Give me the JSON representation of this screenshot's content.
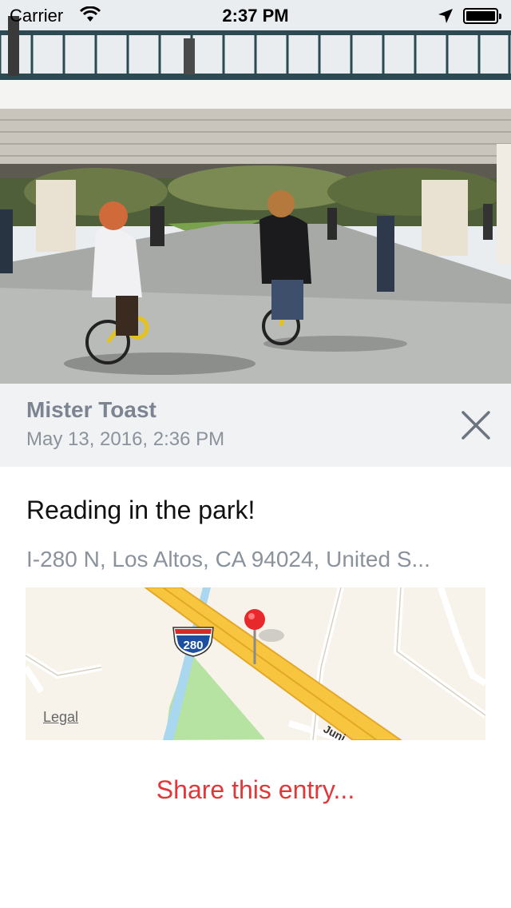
{
  "status_bar": {
    "carrier": "Carrier",
    "time": "2:37 PM",
    "icons": [
      "wifi-icon",
      "location-arrow-icon",
      "battery-icon"
    ]
  },
  "photo": {
    "subject": "photo-cyclists-under-bridge"
  },
  "entry": {
    "author": "Mister Toast",
    "date": "May 13, 2016, 2:36 PM",
    "title": "Reading in the park!",
    "address": "I-280 N, Los Altos, CA  94024, United S..."
  },
  "map": {
    "highway_shield": "280",
    "street_label": "Juni",
    "legal_label": "Legal"
  },
  "actions": {
    "close_icon": "close-icon",
    "share_label": "Share this entry..."
  },
  "colors": {
    "accent": "#e0373a",
    "info_band": "#f1f2f4",
    "secondary_text": "#8a929c"
  }
}
